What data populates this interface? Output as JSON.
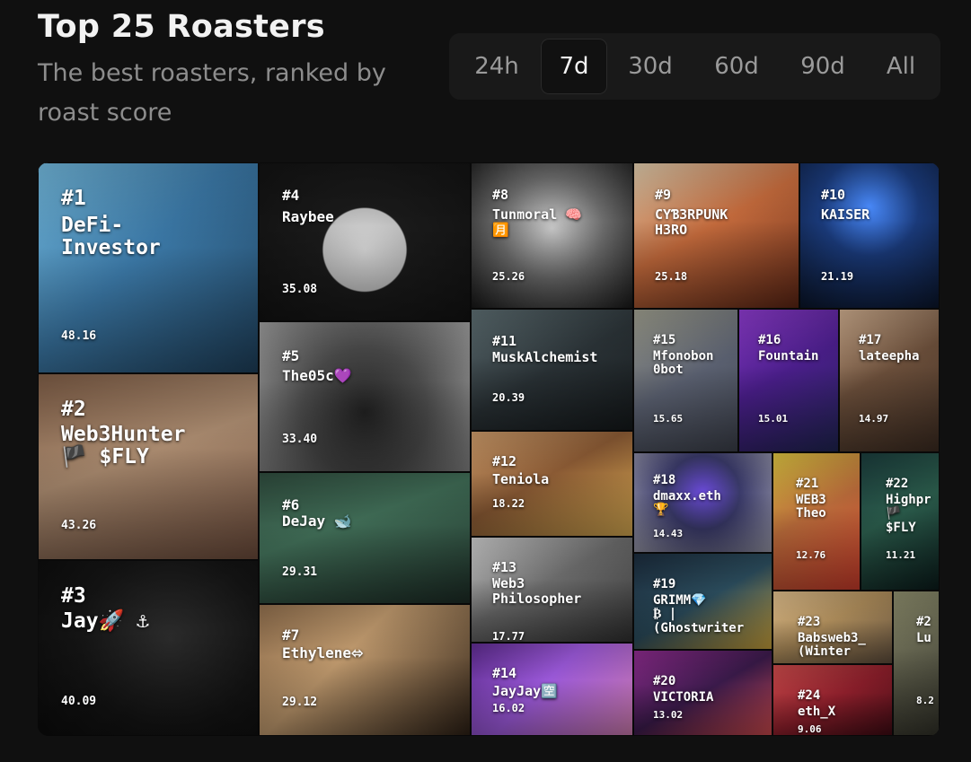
{
  "header": {
    "title": "Top 25 Roasters",
    "subtitle": "The best roasters, ranked by roast score"
  },
  "time_range": {
    "options": [
      "24h",
      "7d",
      "30d",
      "60d",
      "90d",
      "All"
    ],
    "selected": "7d"
  },
  "roasters": [
    {
      "rank": "#1",
      "name": "DeFi-\nInvestor",
      "score": "48.16",
      "bg": "linear-gradient(135deg,#6fb3d6 0%,#3b78a6 45%,#1e3f5a 100%)"
    },
    {
      "rank": "#2",
      "name": "Web3Hunter\n🏴 $FLY",
      "score": "43.26",
      "bg": "linear-gradient(160deg,#7a5a44 0%,#a8896e 45%,#6a4a3a 100%)"
    },
    {
      "rank": "#3",
      "name": "Jay🚀 ⚓",
      "score": "40.09",
      "bg": "radial-gradient(circle at 60% 45%,#2b2b2b 0%,#141414 55%,#0b0b0b 100%)"
    },
    {
      "rank": "#4",
      "name": "Raybee",
      "score": "35.08",
      "bg": "radial-gradient(circle at 50% 55%,#d8d8d8 0%,#bdbdbd 30%,#1a1a1a 31%,#111 100%)"
    },
    {
      "rank": "#5",
      "name": "The05c💜",
      "score": "33.40",
      "bg": "radial-gradient(circle at 50% 60%,#202020 0%,#4a4a4a 45%,#9a9a9a 100%)"
    },
    {
      "rank": "#6",
      "name": "DeJay 🐋",
      "score": "29.31",
      "bg": "linear-gradient(160deg,#2e4a3c 0%,#3f6b55 40%,#1b2a24 100%)"
    },
    {
      "rank": "#7",
      "name": "Ethylene⬄",
      "score": "29.12",
      "bg": "linear-gradient(135deg,#8a6a4a 0%,#c09a6e 40%,#2a1e14 100%)"
    },
    {
      "rank": "#8",
      "name": "Tunmoral 🧠\n🈷️",
      "score": "25.26",
      "bg": "radial-gradient(circle at 50% 45%,#c9c9c9 0%,#6c6c6c 45%,#161616 100%)"
    },
    {
      "rank": "#9",
      "name": "CYƁ3RPUNK\nH3RO",
      "score": "25.18",
      "bg": "linear-gradient(150deg,#d8c6a8 0%,#c36a3c 45%,#5a2414 100%)"
    },
    {
      "rank": "#10",
      "name": "KAISER",
      "score": "21.19",
      "bg": "radial-gradient(circle at 50% 30%,#4a8cff 0%,#1a3a7a 40%,#0a1428 100%)"
    },
    {
      "rank": "#11",
      "name": "MuskAlchemist",
      "score": "20.39",
      "bg": "linear-gradient(150deg,#5a6a6e 0%,#2a3236 50%,#14181a 100%)"
    },
    {
      "rank": "#12",
      "name": "Teniola",
      "score": "18.22",
      "bg": "linear-gradient(150deg,#c89868 0%,#8a5a34 45%,#d4a850 100%)"
    },
    {
      "rank": "#13",
      "name": "Web3\nPhilosopher",
      "score": "17.77",
      "bg": "linear-gradient(150deg,#c8c8c8 0%,#6a6a6a 45%,#2e2e2e 100%)"
    },
    {
      "rank": "#14",
      "name": "JayJay🈳",
      "score": "16.02",
      "bg": "linear-gradient(135deg,#5a2a8a 0%,#9a58d8 45%,#c878a8 100%)"
    },
    {
      "rank": "#15",
      "name": "Mfonobon\n0bot",
      "score": "15.65",
      "bg": "linear-gradient(150deg,#9a9a8a 0%,#5a6070 50%,#3a3e48 100%)"
    },
    {
      "rank": "#16",
      "name": "Fountain",
      "score": "15.01",
      "bg": "linear-gradient(150deg,#8a3ac8 0%,#4a1e8a 45%,#1e2450 100%)"
    },
    {
      "rank": "#17",
      "name": "lateepha",
      "score": "14.97",
      "bg": "linear-gradient(150deg,#c8a88a 0%,#6a4e3a 45%,#3a2a20 100%)"
    },
    {
      "rank": "#18",
      "name": "dmaxx.eth\n🏆",
      "score": "14.43",
      "bg": "radial-gradient(circle at 50% 40%,#6a4ad8 0%,#3a3a6a 40%,#9a9aaa 100%)"
    },
    {
      "rank": "#19",
      "name": "GRIMM💎\n₿ |\n(Ghostwriter",
      "score": "",
      "bg": "linear-gradient(150deg,#1a2a3a 0%,#2a4a5a 50%,#c8a03a 100%)"
    },
    {
      "rank": "#20",
      "name": "VICTORIA",
      "score": "13.02",
      "bg": "linear-gradient(150deg,#8a2a8a 0%,#3a1a4a 50%,#c8484a 100%)"
    },
    {
      "rank": "#21",
      "name": "WEB3\nTheo",
      "score": "12.76",
      "bg": "linear-gradient(150deg,#d8c040 0%,#b86a3a 45%,#c83a2a 100%)"
    },
    {
      "rank": "#22",
      "name": "Highpr\n🏴\n$FLY",
      "score": "11.21",
      "bg": "linear-gradient(150deg,#1a3a3a 0%,#2a5a4a 45%,#0a1a1a 100%)"
    },
    {
      "rank": "#23",
      "name": "Babsweb3_\n(Winter",
      "score": "",
      "bg": "linear-gradient(150deg,#d8b888 0%,#a88858 45%,#5a4a3a 100%)"
    },
    {
      "rank": "#24",
      "name": "eth_X",
      "score": "9.06",
      "bg": "linear-gradient(150deg,#c84a4a 0%,#8a1e2a 50%,#3a0a12 100%)"
    },
    {
      "rank": "#2",
      "name": "Lu",
      "score": "8.2",
      "bg": "linear-gradient(150deg,#8a8a6a 0%,#5a5a48 50%,#2e2e26 100%)"
    }
  ]
}
